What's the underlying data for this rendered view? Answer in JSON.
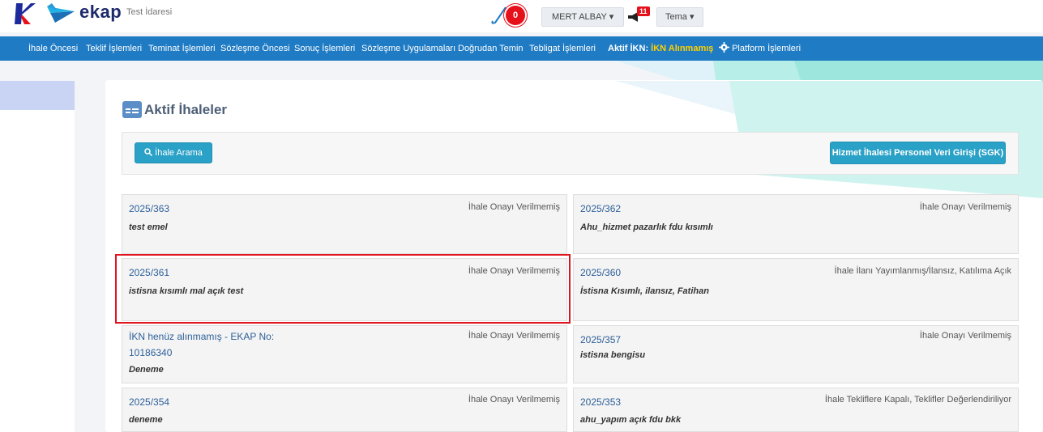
{
  "header": {
    "logo_text": "ekap",
    "org_name": "Test İdaresi",
    "counter": "0",
    "user_label": "MERT ALBAY",
    "notif_count": "11",
    "theme_label": "Tema"
  },
  "nav": {
    "items": [
      "İhale Öncesi",
      "Teklif İşlemleri",
      "Teminat İşlemleri",
      "Sözleşme Öncesi",
      "Sonuç İşlemleri",
      "Sözleşme Uygulamaları",
      "Doğrudan Temin",
      "Tebligat İşlemleri"
    ],
    "ikn_label": "Aktif İKN:",
    "ikn_value": "İKN Alınmamış",
    "platform_label": "Platform İşlemleri"
  },
  "page": {
    "title": "Aktif İhaleler",
    "search_button": "İhale Arama",
    "sgk_button": "Hizmet İhalesi Personel Veri Girişi (SGK)"
  },
  "cards": [
    {
      "no": "2025/363",
      "status": "İhale Onayı Verilmemiş",
      "desc": "test emel"
    },
    {
      "no": "2025/362",
      "status": "İhale Onayı Verilmemiş",
      "desc": "Ahu_hizmet pazarlık fdu kısımlı"
    },
    {
      "no": "2025/361",
      "status": "İhale Onayı Verilmemiş",
      "desc": "istisna kısımlı mal açık test"
    },
    {
      "no": "2025/360",
      "status": "İhale İlanı Yayımlanmış/İlansız, Katılıma Açık",
      "desc": "İstisna Kısımlı, ilansız, Fatihan"
    },
    {
      "no": "İKN henüz alınmamış - EKAP No:",
      "no2": "10186340",
      "status": "İhale Onayı Verilmemiş",
      "desc": "Deneme"
    },
    {
      "no": "2025/357",
      "status": "İhale Onayı Verilmemiş",
      "desc": "istisna bengisu"
    },
    {
      "no": "2025/354",
      "status": "İhale Onayı Verilmemiş",
      "desc": "deneme"
    },
    {
      "no": "2025/353",
      "status": "İhale Tekliflere Kapalı, Teklifler Değerlendiriliyor",
      "desc": "ahu_yapım açık fdu bkk"
    }
  ]
}
